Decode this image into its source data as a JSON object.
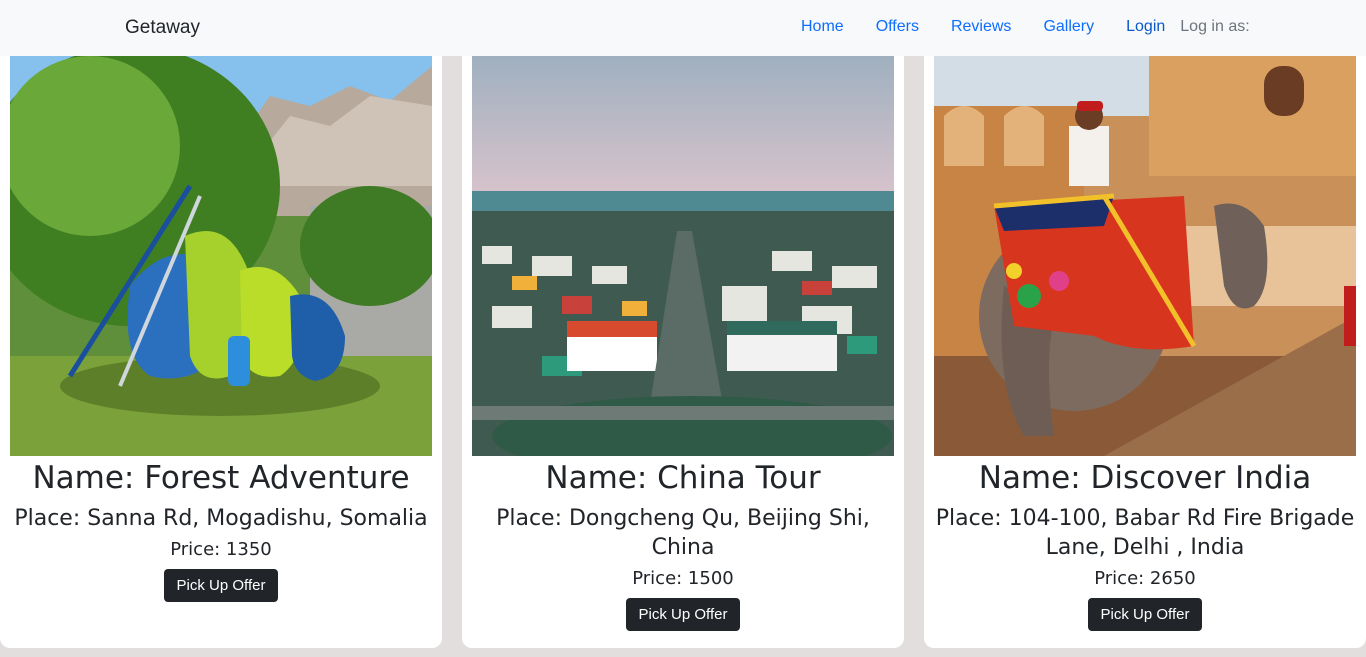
{
  "navbar": {
    "brand": "Getaway",
    "links": [
      "Home",
      "Offers",
      "Reviews",
      "Gallery"
    ],
    "login": "Login",
    "login_as": "Log in as:"
  },
  "cards": [
    {
      "name": "Name: Forest Adventure",
      "place": "Place: Sanna Rd, Mogadishu, Somalia",
      "price": "Price: 1350",
      "button": "Pick Up Offer"
    },
    {
      "name": "Name: China Tour",
      "place": "Place: Dongcheng Qu, Beijing Shi, China",
      "price": "Price: 1500",
      "button": "Pick Up Offer"
    },
    {
      "name": "Name: Discover India",
      "place": "Place: 104-100, Babar Rd Fire Brigade Lane, Delhi , India",
      "price": "Price: 2650",
      "button": "Pick Up Offer"
    }
  ],
  "colors": {
    "page_bg": "#e2dedd",
    "nav_bg": "#f8f9fa",
    "link": "#0d6efd",
    "button_bg": "#212529"
  }
}
